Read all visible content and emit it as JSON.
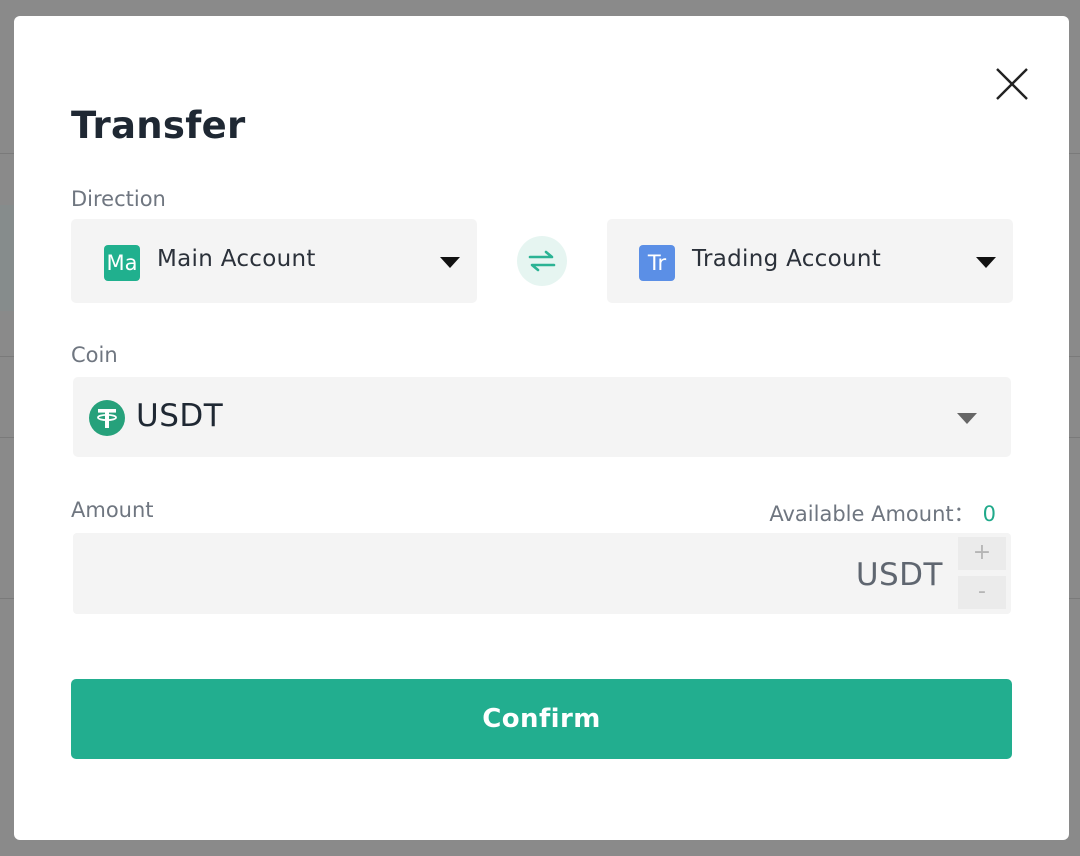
{
  "modal": {
    "title": "Transfer",
    "close_icon": "close-icon"
  },
  "direction": {
    "label": "Direction",
    "from": {
      "badge": "Ma",
      "name": "Main Account",
      "badge_color": "#20b08e"
    },
    "to": {
      "badge": "Tr",
      "name": "Trading Account",
      "badge_color": "#5b8fe6"
    },
    "swap_icon": "swap-arrows-icon"
  },
  "coin": {
    "label": "Coin",
    "selected": "USDT",
    "icon": "tether-icon"
  },
  "amount": {
    "label": "Amount",
    "available_label": "Available Amount：",
    "available_value": "0",
    "value": "",
    "unit": "USDT",
    "increment": "+",
    "decrement": "-"
  },
  "confirm_label": "Confirm",
  "colors": {
    "accent": "#22ae8f",
    "accent_text": "#20a98a",
    "main_badge": "#20b08e",
    "trading_badge": "#5b8fe6"
  }
}
